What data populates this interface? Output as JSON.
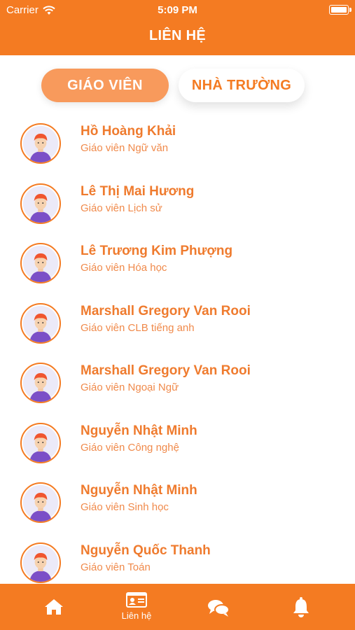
{
  "status": {
    "carrier": "Carrier",
    "time": "5:09 PM"
  },
  "header": {
    "title": "LIÊN HỆ"
  },
  "segments": {
    "teachers": "GIÁO VIÊN",
    "school": "NHÀ TRƯỜNG",
    "selected": "teachers"
  },
  "contacts": [
    {
      "name": "Hồ Hoàng Khải",
      "role": "Giáo viên Ngữ văn"
    },
    {
      "name": "Lê Thị Mai Hương",
      "role": "Giáo viên Lịch sử"
    },
    {
      "name": "Lê Trương Kim Phượng",
      "role": "Giáo viên Hóa học"
    },
    {
      "name": "Marshall Gregory Van Rooi",
      "role": "Giáo viên CLB tiếng anh"
    },
    {
      "name": "Marshall Gregory Van Rooi",
      "role": "Giáo viên Ngoại Ngữ"
    },
    {
      "name": "Nguyễn Nhật Minh",
      "role": "Giáo viên Công nghệ"
    },
    {
      "name": "Nguyễn Nhật Minh",
      "role": "Giáo viên Sinh học"
    },
    {
      "name": "Nguyễn Quốc Thanh",
      "role": "Giáo viên Toán"
    }
  ],
  "tabbar": {
    "items": [
      {
        "icon": "home-icon",
        "label": ""
      },
      {
        "icon": "contact-card-icon",
        "label": "Liên hệ"
      },
      {
        "icon": "chat-icon",
        "label": ""
      },
      {
        "icon": "bell-icon",
        "label": ""
      }
    ],
    "active": 1
  },
  "colors": {
    "primary": "#f47b22",
    "segment_active": "#f89a5c",
    "text_accent": "#ef7b2e"
  }
}
